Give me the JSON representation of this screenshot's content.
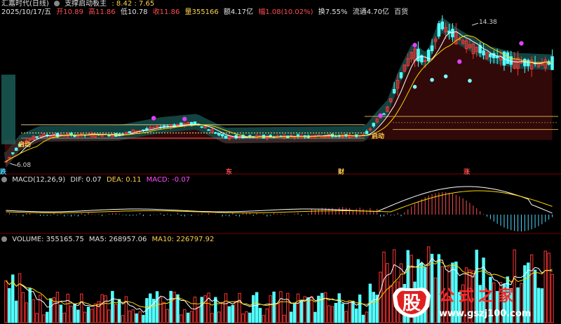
{
  "header": {
    "stock_name": "汇嘉时代(日线)",
    "indicator_name": "支撑启动板主",
    "indicator_values": ": 8.42 : 7.65",
    "date": "2025/10/17/五",
    "open": "开10.89",
    "high": "高11.86",
    "low": "低10.78",
    "close": "收11.86",
    "volume": "量355166",
    "amount": "额4.17亿",
    "change": "幅1.08(10.02%)",
    "turnover": "换7.55%",
    "float_mv": "流通4.70亿",
    "lot": "百货"
  },
  "price_panel": {
    "high_label": "14.38",
    "low_label": "6.08",
    "launch_labels": [
      "启动",
      "启动"
    ],
    "bottom_tags": [
      "跌",
      "东",
      "财",
      "涨"
    ]
  },
  "macd_panel": {
    "title": "MACD(12,26,9)",
    "dif": "DIF: 0.07",
    "dea": "DEA: 0.11",
    "macd": "MACD: -0.07"
  },
  "volume_panel": {
    "volume": "VOLUME: 355165.75",
    "ma5": "MA5: 268957.06",
    "ma10": "MA10: 226797.92"
  },
  "watermark": {
    "glyph": "股",
    "text": "公式之家",
    "url": "www.gszj100.com"
  },
  "colors": {
    "up": "#ff3333",
    "down": "#54ffff",
    "ma_white": "#ffffff",
    "ma_yellow": "#ffd700",
    "band_teal": "#1f6f6a",
    "band_maroon": "#5a1010",
    "magenta": "#e040fb",
    "divider": "#7a0000"
  },
  "chart_data": [
    {
      "type": "candlestick",
      "title": "汇嘉时代(日线)",
      "ylim": [
        6.08,
        14.38
      ],
      "annotations": [
        "14.38",
        "6.08",
        "启动"
      ]
    },
    {
      "type": "bar",
      "title": "MACD(12,26,9)",
      "series": [
        {
          "name": "DIF",
          "values": [
            0.07
          ]
        },
        {
          "name": "DEA",
          "values": [
            0.11
          ]
        },
        {
          "name": "MACD",
          "values": [
            -0.07
          ]
        }
      ]
    },
    {
      "type": "bar",
      "title": "VOLUME",
      "series": [
        {
          "name": "VOLUME",
          "values": [
            355165.75
          ]
        },
        {
          "name": "MA5",
          "values": [
            268957.06
          ]
        },
        {
          "name": "MA10",
          "values": [
            226797.92
          ]
        }
      ]
    }
  ]
}
